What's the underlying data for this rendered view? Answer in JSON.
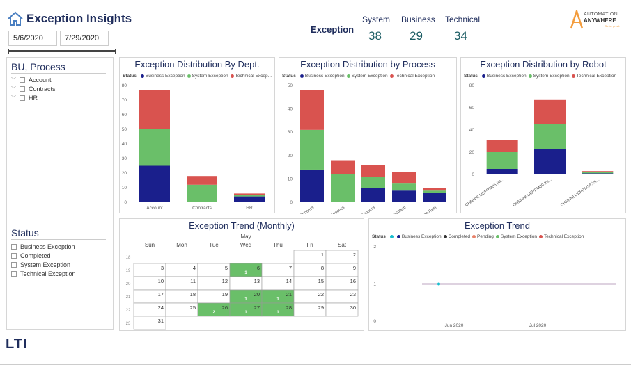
{
  "header": {
    "title": "Exception Insights",
    "date_from": "5/6/2020",
    "date_to": "7/29/2020"
  },
  "kpi": {
    "label": "Exception",
    "items": [
      {
        "label": "System",
        "value": "38"
      },
      {
        "label": "Business",
        "value": "29"
      },
      {
        "label": "Technical",
        "value": "34"
      }
    ]
  },
  "logo": {
    "line1": "AUTOMATION",
    "line2": "ANYWHERE",
    "tagline": "Go be great."
  },
  "brand_logo": "LTI",
  "slicer_bu": {
    "title": "BU, Process",
    "items": [
      "Account",
      "Contracts",
      "HR"
    ]
  },
  "slicer_status": {
    "title": "Status",
    "items": [
      "Business Exception",
      "Completed",
      "System Exception",
      "Technical Exception"
    ]
  },
  "colors": {
    "business": "#1a1f8c",
    "system": "#6abf69",
    "technical": "#d9534f",
    "pending": "#e8826a",
    "completed": "#333333",
    "blank": "#17becf",
    "calendar_fill": "#6abf69"
  },
  "legend_status_label": "Status",
  "chart_data": [
    {
      "type": "bar",
      "stacked": true,
      "title": "Exception Distribution By Dept.",
      "legend": [
        "Business Exception",
        "System Exception",
        "Technical Excep..."
      ],
      "categories": [
        "Account",
        "Contracts",
        "HR"
      ],
      "series": [
        {
          "name": "Business Exception",
          "values": [
            25,
            0,
            4
          ]
        },
        {
          "name": "System Exception",
          "values": [
            25,
            12,
            1
          ]
        },
        {
          "name": "Technical Exception",
          "values": [
            27,
            6,
            1
          ]
        }
      ],
      "yticks": [
        "0",
        "10",
        "20",
        "30",
        "40",
        "50",
        "60",
        "70",
        "80"
      ],
      "ylim": [
        0,
        80
      ]
    },
    {
      "type": "bar",
      "stacked": true,
      "title": "Exception Distribution by Process",
      "legend": [
        "Business Exception",
        "System Exception",
        "Technical Exception"
      ],
      "categories": [
        "ReportProcess",
        "ContractProcess",
        "PayrollProcess",
        "ExtractItem",
        "NotepadTest"
      ],
      "series": [
        {
          "name": "Business Exception",
          "values": [
            14,
            0,
            6,
            5,
            4
          ]
        },
        {
          "name": "System Exception",
          "values": [
            17,
            12,
            5,
            3,
            1
          ]
        },
        {
          "name": "Technical Exception",
          "values": [
            17,
            6,
            5,
            5,
            1
          ]
        }
      ],
      "yticks": [
        "0",
        "10",
        "20",
        "30",
        "40",
        "50"
      ],
      "ylim": [
        0,
        50
      ]
    },
    {
      "type": "bar",
      "stacked": true,
      "title": "Exception Distribution by Robot",
      "legend": [
        "Business Exception",
        "System Exception",
        "Technical Exception"
      ],
      "categories": [
        "CHNNNLUEPRM05.Int...",
        "CHNNNLUEPRM09.Int...",
        "CHNNNLUEPRM14.Int..."
      ],
      "series": [
        {
          "name": "Business Exception",
          "values": [
            5,
            23,
            1
          ]
        },
        {
          "name": "System Exception",
          "values": [
            15,
            22,
            1
          ]
        },
        {
          "name": "Technical Exception",
          "values": [
            11,
            22,
            1
          ]
        }
      ],
      "yticks": [
        "0",
        "20",
        "40",
        "60",
        "80"
      ],
      "ylim": [
        0,
        80
      ]
    },
    {
      "type": "heatmap",
      "title": "Exception Trend (Monthly)",
      "month": "May",
      "weekdays": [
        "Sun",
        "Mon",
        "Tue",
        "Wed",
        "Thu",
        "Fri",
        "Sat"
      ],
      "weeks": [
        {
          "num": "18",
          "days": [
            "",
            "",
            "",
            "",
            "",
            "1",
            "2"
          ]
        },
        {
          "num": "19",
          "days": [
            "3",
            "4",
            "5",
            "6",
            "7",
            "8",
            "9"
          ]
        },
        {
          "num": "20",
          "days": [
            "10",
            "11",
            "12",
            "13",
            "14",
            "15",
            "16"
          ]
        },
        {
          "num": "21",
          "days": [
            "17",
            "18",
            "19",
            "20",
            "21",
            "22",
            "23"
          ]
        },
        {
          "num": "22",
          "days": [
            "24",
            "25",
            "26",
            "27",
            "28",
            "29",
            "30"
          ]
        },
        {
          "num": "23",
          "days": [
            "31",
            "",
            "",
            "",
            "",
            "",
            ""
          ]
        }
      ],
      "counts": [
        {
          "day": "6",
          "count": "1"
        },
        {
          "day": "20",
          "count": "1"
        },
        {
          "day": "21",
          "count": "1"
        },
        {
          "day": "26",
          "count": "2"
        },
        {
          "day": "27",
          "count": "1"
        },
        {
          "day": "28",
          "count": "1"
        }
      ]
    },
    {
      "type": "line",
      "title": "Exception Trend",
      "legend": [
        "",
        "Business Exception",
        "Completed",
        "Pending",
        "System Exception",
        "Technical Exception"
      ],
      "x_ticks": [
        "Jun 2020",
        "Jul 2020"
      ],
      "yticks": [
        "0",
        "1",
        "2"
      ],
      "ylim": [
        0,
        2
      ],
      "series": [
        {
          "name": "Technical Exception",
          "values": [
            1,
            1
          ]
        },
        {
          "name": "Business Exception",
          "values": [
            1,
            1
          ]
        }
      ]
    }
  ]
}
